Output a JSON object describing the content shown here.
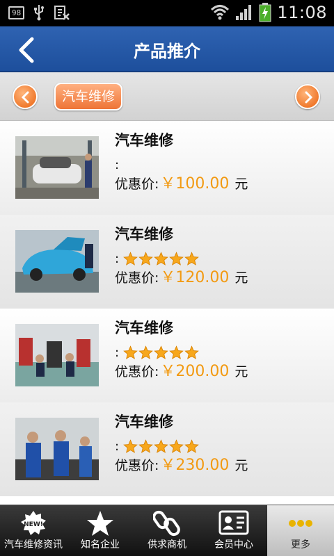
{
  "status_bar": {
    "notification_badge": "98",
    "time": "11:08"
  },
  "header": {
    "title": "产品推介"
  },
  "category_bar": {
    "selected_category": "汽车维修"
  },
  "products": [
    {
      "title": "汽车维修",
      "rating_prefix": ":",
      "stars": 0,
      "price_label": "优惠价:",
      "currency": "￥",
      "price": "100.00",
      "unit": "元"
    },
    {
      "title": "汽车维修",
      "rating_prefix": ":",
      "stars": 5,
      "price_label": "优惠价:",
      "currency": "￥",
      "price": "120.00",
      "unit": "元"
    },
    {
      "title": "汽车维修",
      "rating_prefix": ":",
      "stars": 5,
      "price_label": "优惠价:",
      "currency": "￥",
      "price": "200.00",
      "unit": "元"
    },
    {
      "title": "汽车维修",
      "rating_prefix": ":",
      "stars": 5,
      "price_label": "优惠价:",
      "currency": "￥",
      "price": "230.00",
      "unit": "元"
    }
  ],
  "bottom_nav": [
    {
      "label": "汽车维修资讯",
      "icon": "new-badge-icon"
    },
    {
      "label": "知名企业",
      "icon": "star-icon"
    },
    {
      "label": "供求商机",
      "icon": "chain-link-icon"
    },
    {
      "label": "会员中心",
      "icon": "member-card-icon"
    },
    {
      "label": "更多",
      "icon": "more-dots-icon"
    }
  ],
  "colors": {
    "title_bar": "#2f63b2",
    "accent_orange": "#f07a2e",
    "price": "#f29a12"
  }
}
